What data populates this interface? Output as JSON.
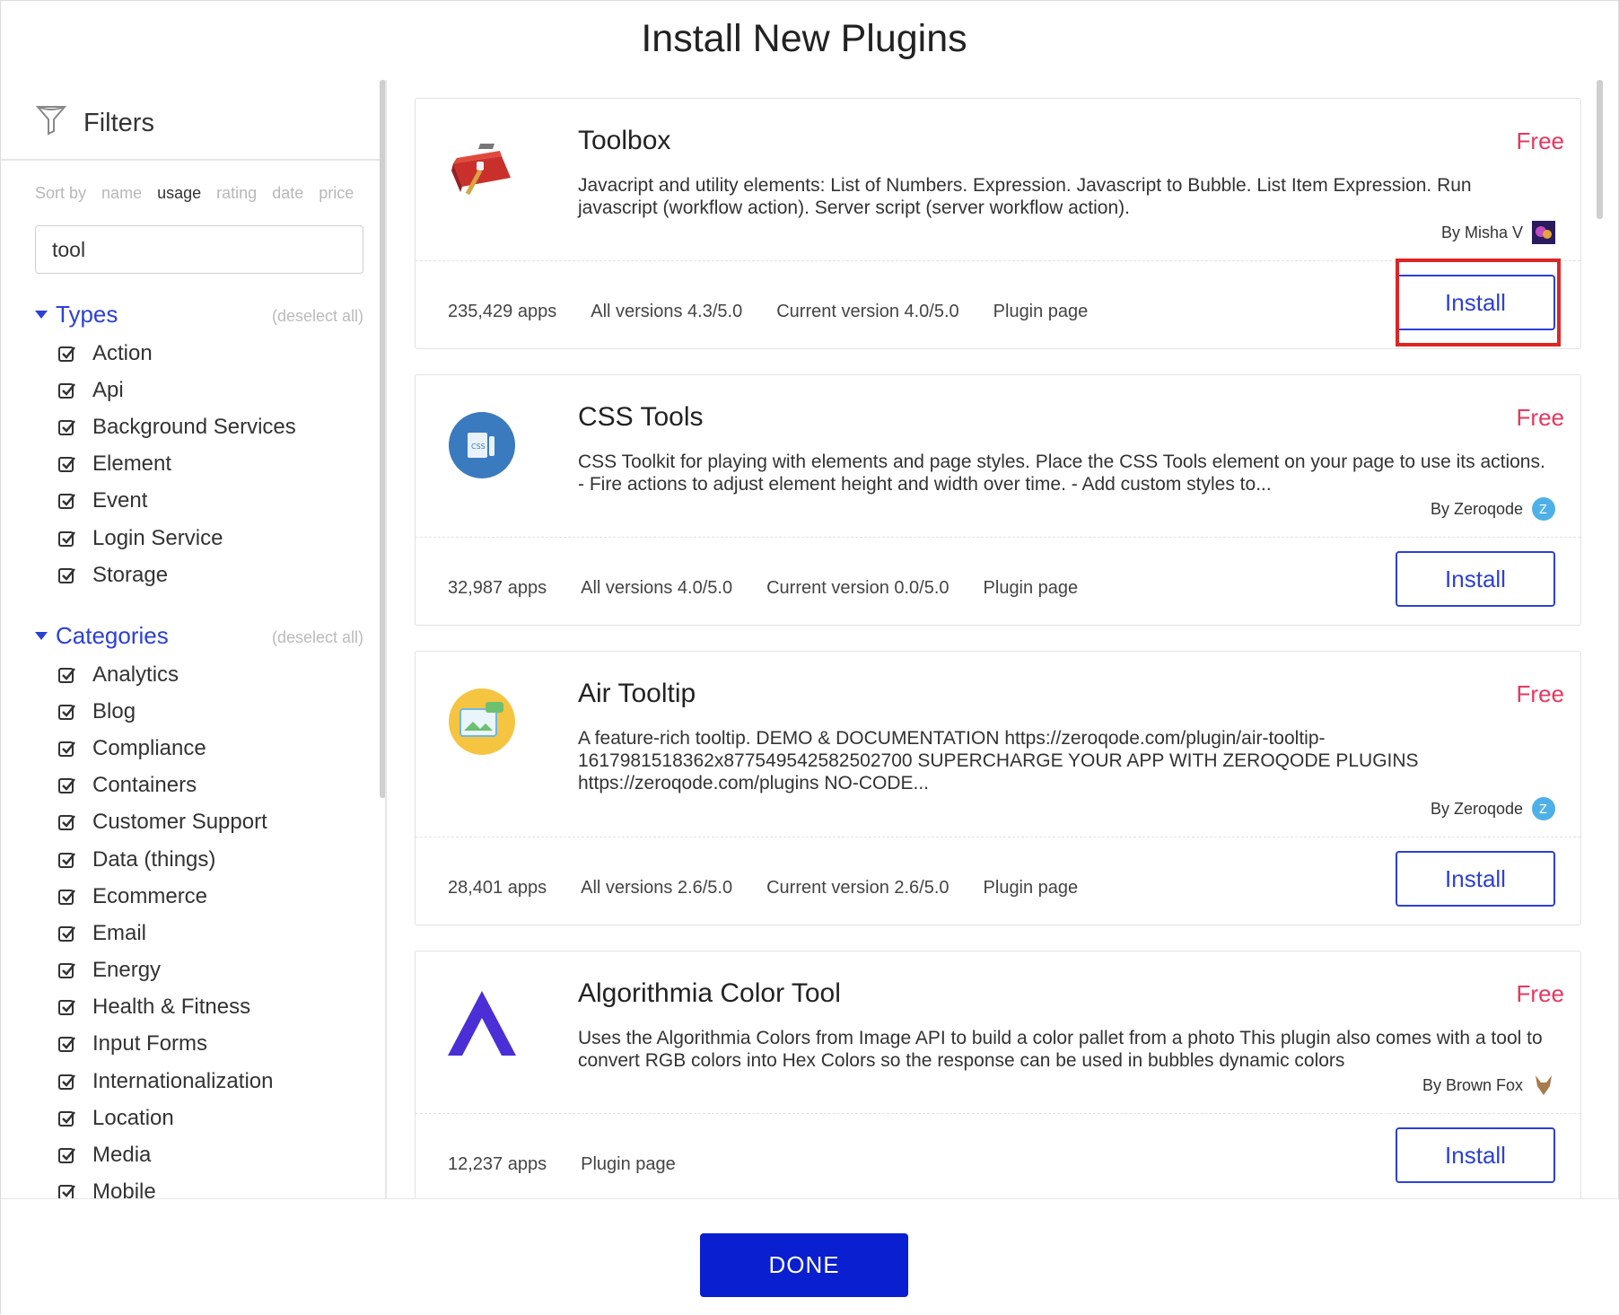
{
  "modal": {
    "title": "Install New Plugins"
  },
  "sidebar": {
    "filters_label": "Filters",
    "sort": {
      "label": "Sort by",
      "options": [
        "name",
        "usage",
        "rating",
        "date",
        "price"
      ],
      "active": "usage"
    },
    "search": {
      "value": "tool"
    },
    "types": {
      "title": "Types",
      "deselect": "(deselect all)",
      "items": [
        "Action",
        "Api",
        "Background Services",
        "Element",
        "Event",
        "Login Service",
        "Storage"
      ]
    },
    "categories": {
      "title": "Categories",
      "deselect": "(deselect all)",
      "items": [
        "Analytics",
        "Blog",
        "Compliance",
        "Containers",
        "Customer Support",
        "Data (things)",
        "Ecommerce",
        "Email",
        "Energy",
        "Health & Fitness",
        "Input Forms",
        "Internationalization",
        "Location",
        "Media",
        "Mobile"
      ]
    }
  },
  "plugins": [
    {
      "name": "Toolbox",
      "price": "Free",
      "description": "Javacript and utility elements: List of Numbers. Expression. Javascript to Bubble. List Item Expression. Run javascript (workflow action). Server script (server workflow action).",
      "author": "By Misha V",
      "apps": "235,429 apps",
      "all_versions": "All versions 4.3/5.0",
      "current_version": "Current version 4.0/5.0",
      "plugin_page": "Plugin page",
      "install": "Install",
      "icon": "toolbox-icon"
    },
    {
      "name": "CSS Tools",
      "price": "Free",
      "description": "CSS Toolkit for playing with elements and page styles. Place the CSS Tools element on your page to use its actions. - Fire actions to adjust element height and width over time. - Add custom styles to...",
      "author": "By Zeroqode",
      "apps": "32,987 apps",
      "all_versions": "All versions 4.0/5.0",
      "current_version": "Current version 0.0/5.0",
      "plugin_page": "Plugin page",
      "install": "Install",
      "icon": "css-tools-icon"
    },
    {
      "name": "Air Tooltip",
      "price": "Free",
      "description": "A feature-rich tooltip. DEMO & DOCUMENTATION https://zeroqode.com/plugin/air-tooltip-1617981518362x877549542582502700 SUPERCHARGE YOUR APP WITH ZEROQODE PLUGINS https://zeroqode.com/plugins NO-CODE...",
      "author": "By Zeroqode",
      "apps": "28,401 apps",
      "all_versions": "All versions 2.6/5.0",
      "current_version": "Current version 2.6/5.0",
      "plugin_page": "Plugin page",
      "install": "Install",
      "icon": "air-tooltip-icon"
    },
    {
      "name": "Algorithmia Color Tool",
      "price": "Free",
      "description": "Uses the Algorithmia Colors from Image API to build a color pallet from a photo This plugin also comes with a tool to convert RGB colors into Hex Colors so the response can be used in bubbles dynamic colors",
      "author": "By Brown Fox",
      "apps": "12,237 apps",
      "plugin_page": "Plugin page",
      "install": "Install",
      "icon": "algorithmia-icon"
    }
  ],
  "footer": {
    "done_label": "DONE"
  },
  "colors": {
    "accent": "#2c40d8",
    "price": "#e8375f",
    "done": "#0a1fcf",
    "highlight": "#e02424"
  }
}
